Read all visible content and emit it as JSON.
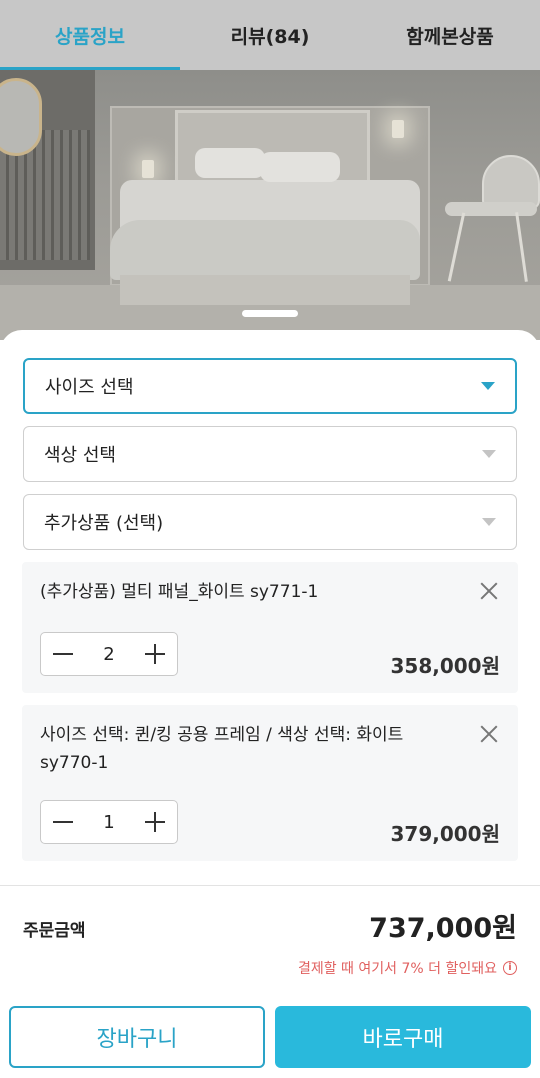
{
  "tabs": [
    {
      "label": "상품정보",
      "active": true
    },
    {
      "label": "리뷰(84)",
      "active": false
    },
    {
      "label": "함께본상품",
      "active": false
    }
  ],
  "options": {
    "size_select": "사이즈 선택",
    "color_select": "색상 선택",
    "addon_select": "추가상품 (선택)"
  },
  "selected_items": [
    {
      "name": "(추가상품) 멀티 패널_화이트 sy771-1",
      "quantity": "2",
      "price": "358,000원"
    },
    {
      "name": "사이즈 선택: 퀸/킹 공용 프레임 / 색상 선택: 화이트 sy770-1",
      "quantity": "1",
      "price": "379,000원"
    }
  ],
  "order": {
    "total_label": "주문금액",
    "total_value": "737,000원",
    "discount_note": "결제할 때 여기서 7% 더 할인돼요",
    "info_icon": "i"
  },
  "actions": {
    "cart_label": "장바구니",
    "buy_label": "바로구매"
  },
  "colors": {
    "accent": "#2aa3c7",
    "buy_button": "#29b9dc",
    "discount": "#e0605f"
  }
}
